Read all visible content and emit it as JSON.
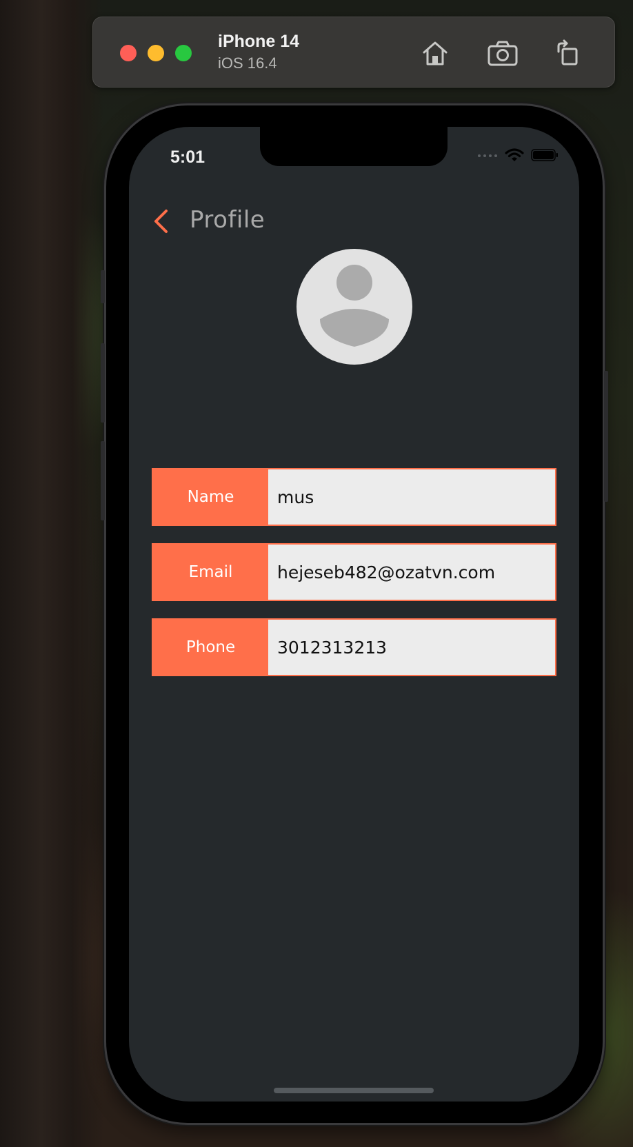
{
  "simulator": {
    "device_name": "iPhone 14",
    "os_version": "iOS 16.4",
    "buttons": {
      "close": "close-window",
      "minimize": "minimize-window",
      "zoom": "zoom-window",
      "home": "home-icon",
      "screenshot": "camera-icon",
      "rotate": "rotate-icon"
    },
    "colors": {
      "close": "#ff5f57",
      "minimize": "#febc2e",
      "zoom": "#28c840"
    }
  },
  "status_bar": {
    "time": "5:01"
  },
  "nav": {
    "title": "Profile",
    "back_icon": "chevron-left-icon"
  },
  "avatar": {
    "icon": "user-placeholder-icon"
  },
  "profile": {
    "fields": [
      {
        "label": "Name",
        "value": "mus"
      },
      {
        "label": "Email",
        "value": "hejeseb482@ozatvn.com"
      },
      {
        "label": "Phone",
        "value": "3012313213"
      }
    ]
  },
  "theme": {
    "accent": "#ff6f4a",
    "screen_bg": "#25292c",
    "field_bg": "#ececec"
  }
}
